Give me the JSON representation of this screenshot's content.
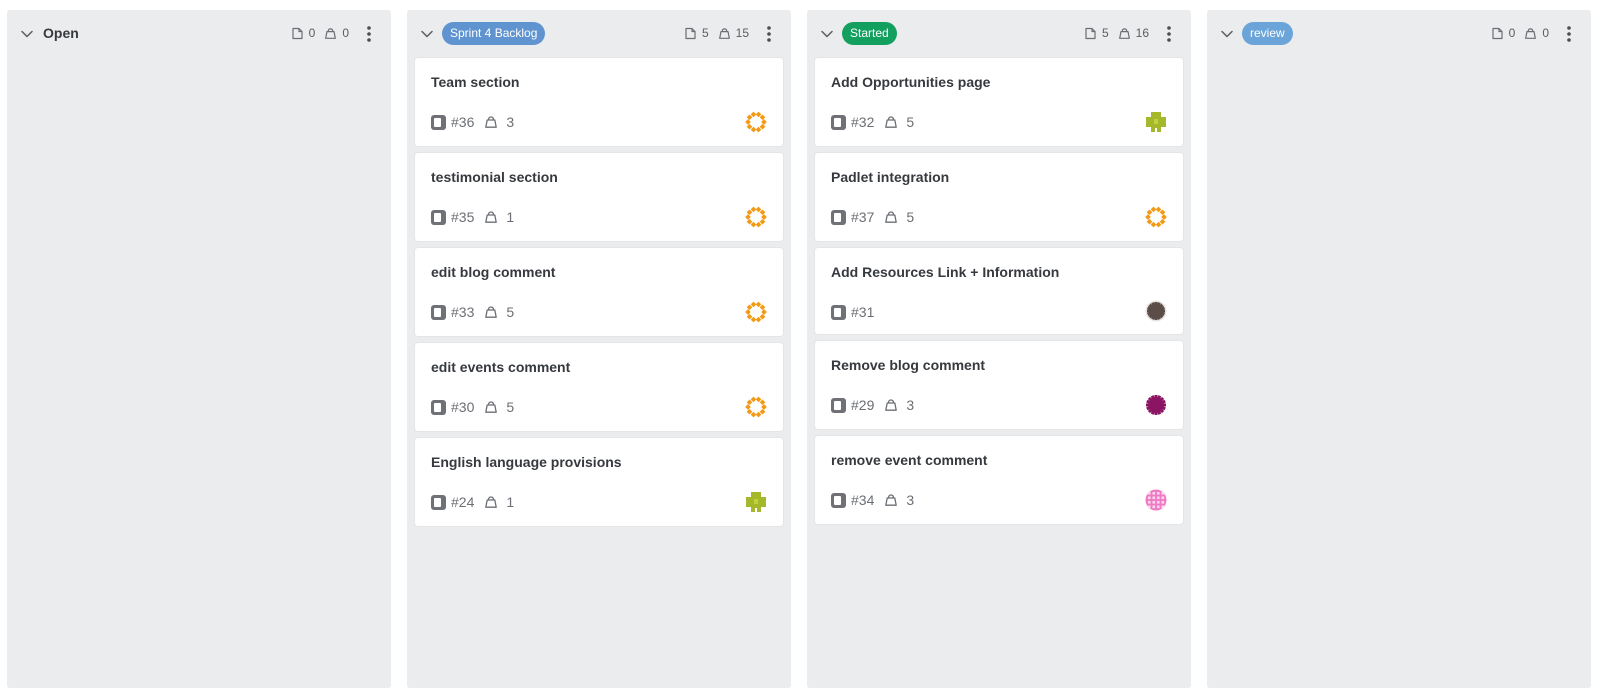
{
  "colors": {
    "column_bg": "#ebeced",
    "card_bg": "#ffffff",
    "sprint_badge": "#5f94d0",
    "started_badge": "#13a05f",
    "review_badge": "#6aa4d8"
  },
  "columns": [
    {
      "title": "Open",
      "title_style": "plain",
      "issue_count": "0",
      "weight": "0",
      "cards": []
    },
    {
      "title": "Sprint 4 Backlog",
      "title_style": "badge",
      "badge_color": "#5f94d0",
      "issue_count": "5",
      "weight": "15",
      "cards": [
        {
          "title": "Team section",
          "number": "#36",
          "weight": "3",
          "avatar": "orange-ring"
        },
        {
          "title": "testimonial section",
          "number": "#35",
          "weight": "1",
          "avatar": "orange-ring"
        },
        {
          "title": "edit blog comment",
          "number": "#33",
          "weight": "5",
          "avatar": "orange-ring"
        },
        {
          "title": "edit events comment",
          "number": "#30",
          "weight": "5",
          "avatar": "orange-ring"
        },
        {
          "title": "English language provisions",
          "number": "#24",
          "weight": "1",
          "avatar": "olive-cross"
        }
      ]
    },
    {
      "title": "Started",
      "title_style": "badge",
      "badge_color": "#13a05f",
      "issue_count": "5",
      "weight": "16",
      "cards": [
        {
          "title": "Add Opportunities page",
          "number": "#32",
          "weight": "5",
          "avatar": "olive-cross"
        },
        {
          "title": "Padlet integration",
          "number": "#37",
          "weight": "5",
          "avatar": "orange-ring"
        },
        {
          "title": "Add Resources Link + Information",
          "number": "#31",
          "weight": "",
          "avatar": "dark-snowflake"
        },
        {
          "title": "Remove blog comment",
          "number": "#29",
          "weight": "3",
          "avatar": "purple-burst"
        },
        {
          "title": "remove event comment",
          "number": "#34",
          "weight": "3",
          "avatar": "pink-grid"
        }
      ]
    },
    {
      "title": "review",
      "title_style": "badge",
      "badge_color": "#6aa4d8",
      "issue_count": "0",
      "weight": "0",
      "cards": []
    }
  ]
}
